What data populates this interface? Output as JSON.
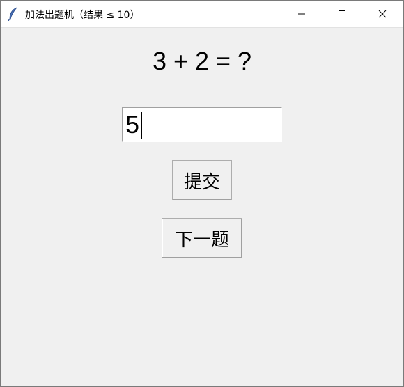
{
  "window": {
    "title": "加法出题机（结果 ≤ 10）",
    "icon": "feather-icon",
    "controls": [
      "minimize-icon",
      "maximize-icon",
      "close-icon"
    ]
  },
  "main": {
    "question": "3 + 2 = ?",
    "answer_value": "5",
    "submit_label": "提交",
    "next_label": "下一题"
  }
}
